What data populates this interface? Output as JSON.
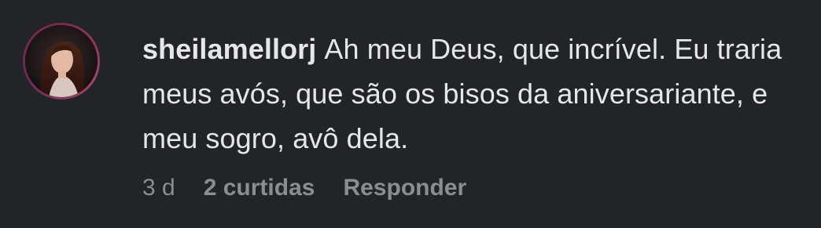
{
  "comment": {
    "username": "sheilamellorj",
    "text": "Ah meu Deus, que incrível. Eu traria meus avós, que são os bisos da aniversariante, e meu sogro, avô dela.",
    "age": "3 d",
    "likes_label": "2 curtidas",
    "reply_label": "Responder"
  },
  "avatar": {
    "icon": "user-profile-photo",
    "ring_color": "#8a3559"
  },
  "colors": {
    "background": "#232428",
    "text": "#e4e6eb",
    "secondary_text": "#8a8d91"
  }
}
